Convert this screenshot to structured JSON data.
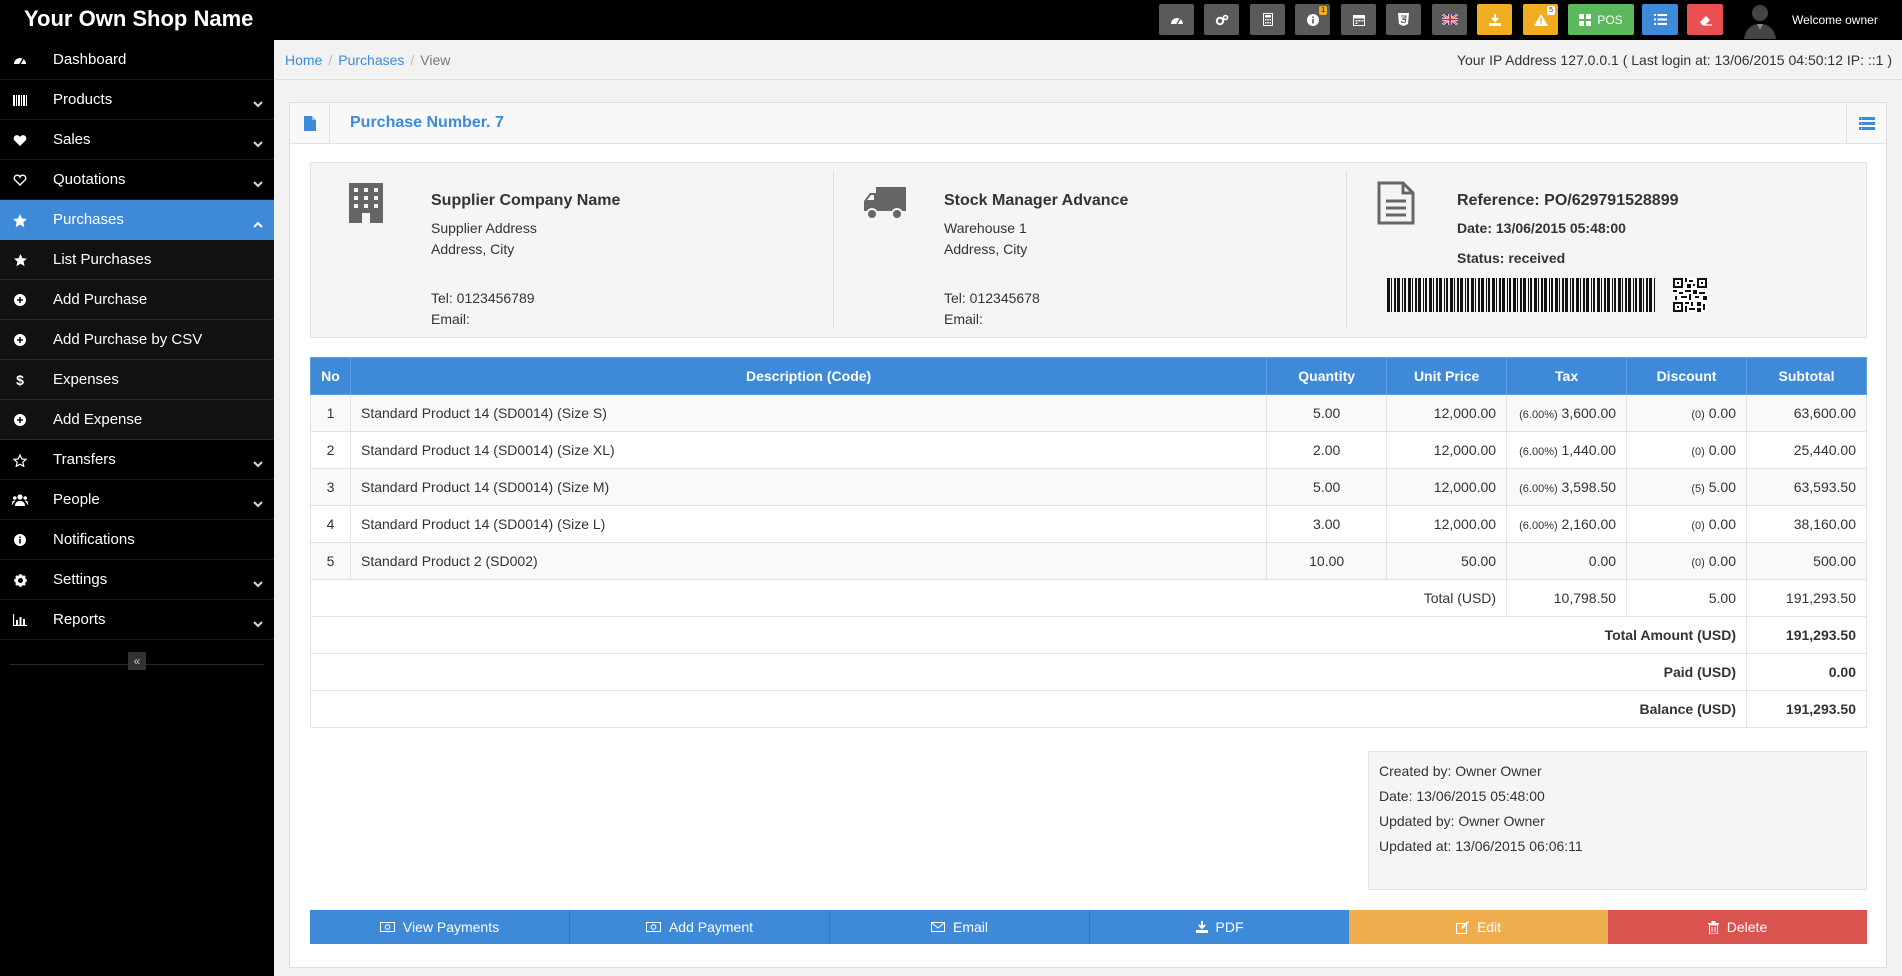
{
  "app": {
    "brand": "Your Own Shop Name",
    "welcome": "Welcome owner"
  },
  "toolbar": {
    "items": [
      {
        "name": "dashboard-icon"
      },
      {
        "name": "settings-icon"
      },
      {
        "name": "calculator-icon"
      },
      {
        "name": "info-icon",
        "badge": "1"
      },
      {
        "name": "calendar-icon"
      },
      {
        "name": "html5-icon"
      },
      {
        "name": "uk-flag-icon"
      },
      {
        "name": "download-icon"
      },
      {
        "name": "warning-icon",
        "badge": "5"
      },
      {
        "name": "pos-icon",
        "label": "POS"
      },
      {
        "name": "list-icon"
      },
      {
        "name": "eraser-icon"
      }
    ]
  },
  "sidebar": {
    "items": [
      {
        "label": "Dashboard",
        "icon": "dashboard-icon"
      },
      {
        "label": "Products",
        "icon": "barcode-icon",
        "has_children": true
      },
      {
        "label": "Sales",
        "icon": "heart-icon",
        "has_children": true
      },
      {
        "label": "Quotations",
        "icon": "heart-outline-icon",
        "has_children": true
      },
      {
        "label": "Purchases",
        "icon": "star-icon",
        "has_children": true,
        "active": true
      },
      {
        "label": "List Purchases",
        "icon": "star-icon",
        "sub": true
      },
      {
        "label": "Add Purchase",
        "icon": "plus-circle-icon",
        "sub": true
      },
      {
        "label": "Add Purchase by CSV",
        "icon": "plus-circle-icon",
        "sub": true
      },
      {
        "label": "Expenses",
        "icon": "dollar-icon",
        "sub": true
      },
      {
        "label": "Add Expense",
        "icon": "plus-circle-icon",
        "sub": true
      },
      {
        "label": "Transfers",
        "icon": "star-outline-icon",
        "has_children": true
      },
      {
        "label": "People",
        "icon": "users-icon",
        "has_children": true
      },
      {
        "label": "Notifications",
        "icon": "info-icon"
      },
      {
        "label": "Settings",
        "icon": "gear-icon",
        "has_children": true
      },
      {
        "label": "Reports",
        "icon": "bar-chart-icon",
        "has_children": true
      }
    ],
    "collapse_glyph": "«"
  },
  "breadcrumb": {
    "home": "Home",
    "section": "Purchases",
    "current": "View"
  },
  "ip_info": "Your IP Address 127.0.0.1 ( Last login at: 13/06/2015 04:50:12 IP: ::1 )",
  "panel": {
    "title": "Purchase Number. 7"
  },
  "supplier": {
    "name": "Supplier Company Name",
    "address1": "Supplier Address",
    "address2": "Address, City",
    "tel": "Tel: 0123456789",
    "email": "Email:"
  },
  "warehouse": {
    "name": "Stock Manager Advance",
    "address1": "Warehouse 1",
    "address2": "Address, City",
    "tel": "Tel: 012345678",
    "email": "Email:"
  },
  "reference": {
    "ref": "Reference: PO/629791528899",
    "date": "Date: 13/06/2015 05:48:00",
    "status": "Status: received"
  },
  "table": {
    "headers": [
      "No",
      "Description (Code)",
      "Quantity",
      "Unit Price",
      "Tax",
      "Discount",
      "Subtotal"
    ],
    "rows": [
      {
        "no": "1",
        "desc": "Standard Product 14 (SD0014) (Size S)",
        "qty": "5.00",
        "price": "12,000.00",
        "tax_rate": "(6.00%)",
        "tax": "3,600.00",
        "disc_rate": "(0)",
        "disc": "0.00",
        "subtotal": "63,600.00"
      },
      {
        "no": "2",
        "desc": "Standard Product 14 (SD0014) (Size XL)",
        "qty": "2.00",
        "price": "12,000.00",
        "tax_rate": "(6.00%)",
        "tax": "1,440.00",
        "disc_rate": "(0)",
        "disc": "0.00",
        "subtotal": "25,440.00"
      },
      {
        "no": "3",
        "desc": "Standard Product 14 (SD0014) (Size M)",
        "qty": "5.00",
        "price": "12,000.00",
        "tax_rate": "(6.00%)",
        "tax": "3,598.50",
        "disc_rate": "(5)",
        "disc": "5.00",
        "subtotal": "63,593.50"
      },
      {
        "no": "4",
        "desc": "Standard Product 14 (SD0014) (Size L)",
        "qty": "3.00",
        "price": "12,000.00",
        "tax_rate": "(6.00%)",
        "tax": "2,160.00",
        "disc_rate": "(0)",
        "disc": "0.00",
        "subtotal": "38,160.00"
      },
      {
        "no": "5",
        "desc": "Standard Product 2 (SD002)",
        "qty": "10.00",
        "price": "50.00",
        "tax_rate": "",
        "tax": "0.00",
        "disc_rate": "(0)",
        "disc": "0.00",
        "subtotal": "500.00"
      }
    ],
    "total_label": "Total (USD)",
    "total_tax": "10,798.50",
    "total_discount": "5.00",
    "total_subtotal": "191,293.50",
    "total_amount_label": "Total Amount (USD)",
    "total_amount": "191,293.50",
    "paid_label": "Paid (USD)",
    "paid": "0.00",
    "balance_label": "Balance (USD)",
    "balance": "191,293.50"
  },
  "meta": {
    "created_by": "Created by: Owner Owner",
    "date": "Date: 13/06/2015 05:48:00",
    "updated_by": "Updated by: Owner Owner",
    "updated_at": "Updated at: 13/06/2015 06:06:11"
  },
  "actions": {
    "view_payments": "View Payments",
    "add_payment": "Add Payment",
    "email": "Email",
    "pdf": "PDF",
    "edit": "Edit",
    "delete": "Delete"
  },
  "colors": {
    "accent": "#3e8ad8",
    "warning": "#f0ad4e",
    "danger": "#d9534f",
    "success": "#5cb85c",
    "header": "#000000"
  }
}
